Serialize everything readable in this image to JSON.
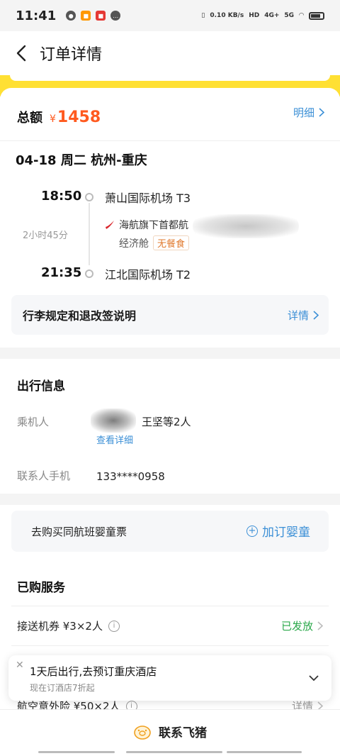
{
  "status_bar": {
    "time": "11:41",
    "net_speed": "0.10 KB/s",
    "hd": "HD",
    "signal_1": "4G+",
    "signal_2": "5G"
  },
  "nav": {
    "title": "订单详情"
  },
  "order": {
    "total_label": "总额",
    "currency": "¥",
    "total_amount": "1458",
    "detail_link": "明细"
  },
  "flight": {
    "route": "04-18 周二 杭州-重庆",
    "depart_time": "18:50",
    "depart_airport": "萧山国际机场 T3",
    "duration": "2小时45分",
    "airline": "海航旗下首都航",
    "cabin": "经济舱",
    "meal": "无餐食",
    "arrive_time": "21:35",
    "arrive_airport": "江北国际机场 T2",
    "luggage_label": "行李规定和退改签说明",
    "luggage_link": "详情"
  },
  "travel": {
    "section_title": "出行信息",
    "passenger_label": "乘机人",
    "passenger_value": "王坚等2人",
    "view_detail": "查看详细",
    "contact_label": "联系人手机",
    "contact_value": "133****0958"
  },
  "infant": {
    "text": "去购买同航班婴童票",
    "button": "加订婴童"
  },
  "services": {
    "section_title": "已购服务",
    "items": [
      {
        "label": "接送机券 ¥3×2人",
        "status": "已发放"
      },
      {
        "label": "航空意外险 ¥50×2人",
        "status": "详情"
      }
    ]
  },
  "hotel_popup": {
    "title": "1天后出行,去预订重庆酒店",
    "subtitle": "现在订酒店7折起"
  },
  "bottom": {
    "contact": "联系飞猪"
  },
  "colors": {
    "accent": "#ff5a1f",
    "link": "#3b8fd6",
    "green": "#2aa84a",
    "yellow": "#ffe033"
  }
}
